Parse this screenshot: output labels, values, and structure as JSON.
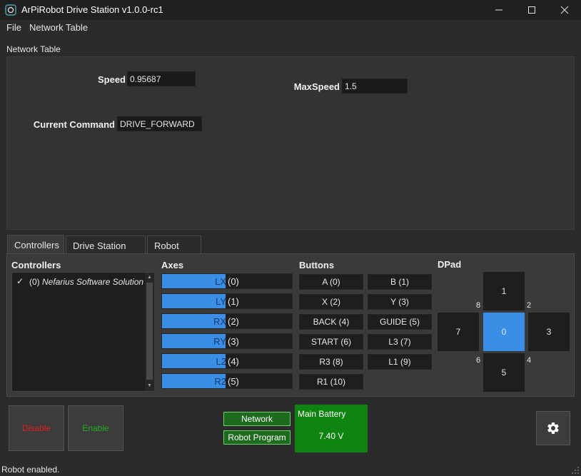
{
  "window": {
    "title": "ArPiRobot Drive Station v1.0.0-rc1"
  },
  "menu": {
    "items": [
      "File",
      "Network Table"
    ]
  },
  "network_table": {
    "label": "Network Table",
    "fields": [
      {
        "label": "Speed",
        "value": "0.95687"
      },
      {
        "label": "MaxSpeed",
        "value": "1.5"
      },
      {
        "label": "Current Command",
        "value": "DRIVE_FORWARD"
      }
    ]
  },
  "tabs": [
    {
      "label": "Controllers",
      "active": true
    },
    {
      "label": "Drive Station Log",
      "active": false
    },
    {
      "label": "Robot Log",
      "active": false
    }
  ],
  "controllers": {
    "title": "Controllers",
    "checked_mark": "✓",
    "items": [
      {
        "index": "(0)",
        "name": "Nefarius Software Solutions"
      }
    ]
  },
  "axes": {
    "title": "Axes",
    "items": [
      {
        "name": "LX",
        "index": "(0)",
        "level": 0.49
      },
      {
        "name": "LY",
        "index": "(1)",
        "level": 0.49
      },
      {
        "name": "RX",
        "index": "(2)",
        "level": 0.49
      },
      {
        "name": "RY",
        "index": "(3)",
        "level": 0.49
      },
      {
        "name": "L2",
        "index": "(4)",
        "level": 0.49
      },
      {
        "name": "R2",
        "index": "(5)",
        "level": 0.49
      }
    ]
  },
  "buttons": {
    "title": "Buttons",
    "items": [
      "A (0)",
      "B (1)",
      "X (2)",
      "Y (3)",
      "BACK (4)",
      "GUIDE (5)",
      "START (6)",
      "L3 (7)",
      "R3 (8)",
      "L1 (9)",
      "R1 (10)"
    ]
  },
  "dpad": {
    "title": "DPad",
    "up": "1",
    "left": "7",
    "center": "0",
    "right": "3",
    "down": "5",
    "diag_up_left": "8",
    "diag_up_right": "2",
    "diag_down_left": "6",
    "diag_down_right": "4",
    "active": "0"
  },
  "controls": {
    "disable_label": "Disable",
    "enable_label": "Enable",
    "network_label": "Network",
    "robot_program_label": "Robot Program",
    "battery_title": "Main Battery",
    "battery_value": "7.40 V"
  },
  "colors": {
    "disable_text": "#e02020",
    "enable_text": "#20b020",
    "accent_blue": "#3a8ee6",
    "battery_green": "#108410"
  },
  "icons": {
    "settings": "gear-icon",
    "app": "app-logo-icon"
  },
  "status_bar": {
    "text": "Robot enabled."
  }
}
